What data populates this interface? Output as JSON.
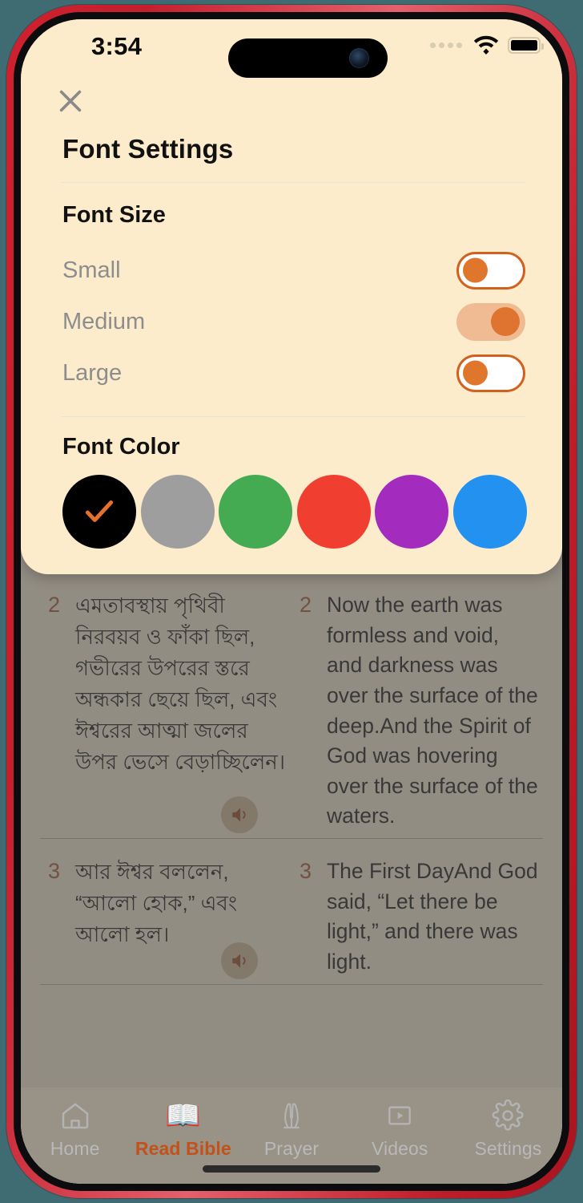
{
  "status_bar": {
    "time": "3:54",
    "signal_icon": "signal-dots-icon",
    "wifi_icon": "wifi-icon",
    "battery_icon": "battery-full-icon"
  },
  "font_sheet": {
    "close_icon": "close-icon",
    "title": "Font Settings",
    "font_size": {
      "section_title": "Font Size",
      "options": [
        {
          "label": "Small",
          "enabled": false
        },
        {
          "label": "Medium",
          "enabled": true
        },
        {
          "label": "Large",
          "enabled": false
        }
      ]
    },
    "font_color": {
      "section_title": "Font Color",
      "selected_index": 0,
      "check_icon": "check-icon",
      "swatches": [
        {
          "name": "black",
          "hex": "#000000",
          "selected": true
        },
        {
          "name": "gray",
          "hex": "#9e9e9e",
          "selected": false
        },
        {
          "name": "green",
          "hex": "#44ab52",
          "selected": false
        },
        {
          "name": "red",
          "hex": "#f03e31",
          "selected": false
        },
        {
          "name": "purple",
          "hex": "#a32bbd",
          "selected": false
        },
        {
          "name": "blue",
          "hex": "#2291ef",
          "selected": false
        }
      ]
    },
    "accent_color": "#d2611f"
  },
  "reader": {
    "audio_icon": "speaker-icon",
    "verses": [
      {
        "number": "2",
        "bengali": "এমতাবস্থায় পৃথিবী নিরবয়ব ও ফাঁকা ছিল, গভীরের উপরের স্তরে অন্ধকার ছেয়ে ছিল, এবং ঈশ্বরের আত্মা জলের উপর ভেসে বেড়াচ্ছিলেন।",
        "english": "Now the earth was formless and void, and darkness was over the surface of the deep.And the Spirit of God was hovering over the surface of the waters."
      },
      {
        "number": "3",
        "bengali": "আর ঈশ্বর বললেন, “আলো হোক,” এবং আলো হল।",
        "english": "The First DayAnd God said, “Let there be light,” and there was light."
      }
    ]
  },
  "tab_bar": {
    "tabs": [
      {
        "label": "Home",
        "icon": "home-icon",
        "active": false
      },
      {
        "label": "Read Bible",
        "icon": "bible-icon",
        "active": true
      },
      {
        "label": "Prayer",
        "icon": "prayer-icon",
        "active": false
      },
      {
        "label": "Videos",
        "icon": "videos-icon",
        "active": false
      },
      {
        "label": "Settings",
        "icon": "settings-icon",
        "active": false
      }
    ]
  }
}
